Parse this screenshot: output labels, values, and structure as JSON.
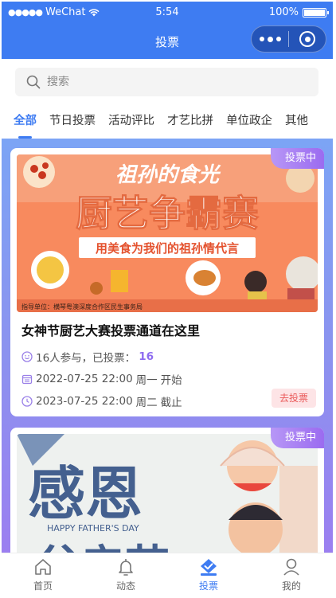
{
  "status_bar": {
    "carrier": "WeChat",
    "time": "5:54",
    "battery": "100%"
  },
  "nav": {
    "title": "投票"
  },
  "search": {
    "placeholder": "搜索"
  },
  "tabs": [
    {
      "label": "全部",
      "active": true
    },
    {
      "label": "节日投票",
      "active": false
    },
    {
      "label": "活动评比",
      "active": false
    },
    {
      "label": "才艺比拼",
      "active": false
    },
    {
      "label": "单位政企",
      "active": false
    },
    {
      "label": "其他",
      "active": false
    }
  ],
  "cards": [
    {
      "badge": "投票中",
      "banner": {
        "top_text": "祖孙的食光",
        "main_text": "厨艺争霸赛",
        "sub_text": "用美食为我们的祖孙情代言",
        "footer_text": "指导单位：横琴粤澳深度合作区民生事务局"
      },
      "title": "女神节厨艺大赛投票通道在这里",
      "participants_text": "16人参与，已投票：",
      "votes": "16",
      "start_date": "2022-07-25 22:00",
      "start_weekday": "周一",
      "start_label": "开始",
      "end_date": "2023-07-25 22:00",
      "end_weekday": "周二",
      "end_label": "截止",
      "vote_button": "去投票"
    },
    {
      "badge": "投票中",
      "banner": {
        "main_text": "感恩",
        "sub_text": "HAPPY FATHER'S DAY",
        "bottom_text": "父亲节"
      }
    }
  ],
  "tabbar": [
    {
      "label": "首页",
      "icon": "home-icon",
      "active": false
    },
    {
      "label": "动态",
      "icon": "bell-icon",
      "active": false
    },
    {
      "label": "投票",
      "icon": "vote-icon",
      "active": true
    },
    {
      "label": "我的",
      "icon": "user-icon",
      "active": false
    }
  ],
  "colors": {
    "primary": "#3e7cf2",
    "badge": "#9b6bf0",
    "vote_button_text": "#ea5a5a"
  }
}
